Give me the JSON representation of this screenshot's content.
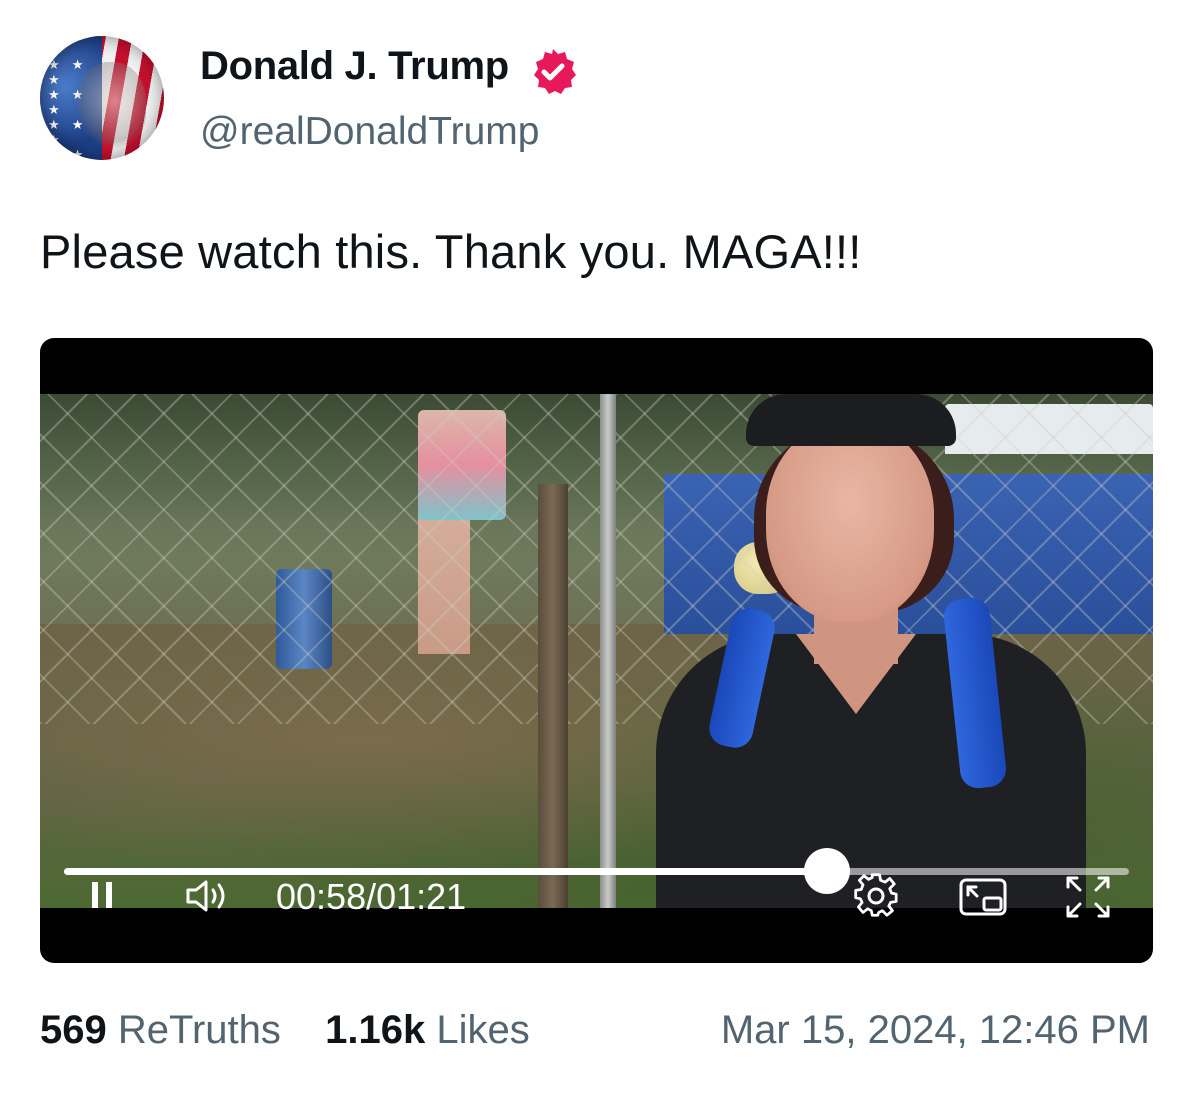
{
  "author": {
    "display_name": "Donald J. Trump",
    "handle": "@realDonaldTrump",
    "verified": true,
    "verified_color": "#e7195a"
  },
  "post": {
    "text": "Please watch this. Thank you. MAGA!!!"
  },
  "video": {
    "current_time": "00:58",
    "duration": "01:21",
    "time_separator": "/",
    "progress": 0.716,
    "playing": true,
    "icons": {
      "play_pause": "pause-icon",
      "volume": "volume-icon",
      "settings": "gear-icon",
      "pip": "picture-in-picture-icon",
      "fullscreen": "fullscreen-icon"
    }
  },
  "stats": {
    "retruths_count": "569",
    "retruths_label": "ReTruths",
    "likes_count": "1.16k",
    "likes_label": "Likes"
  },
  "timestamp": "Mar 15, 2024, 12:46 PM",
  "colors": {
    "text_primary": "#0f1419",
    "text_secondary": "#536471",
    "video_bg": "#000000"
  }
}
